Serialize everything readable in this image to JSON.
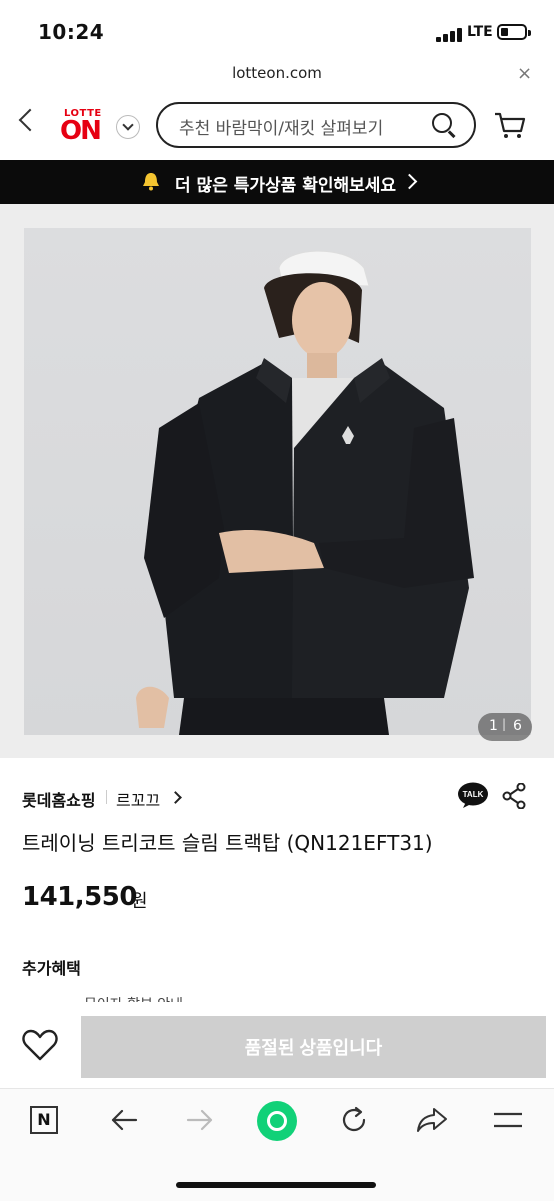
{
  "status_bar": {
    "time": "10:24",
    "network": "LTE",
    "battery_level": 0.25
  },
  "browser": {
    "url": "lotteon.com",
    "close_label": "×"
  },
  "header": {
    "logo_top": "LOTTE",
    "logo_main": "ON",
    "search_placeholder": "추천 바람막이/재킷 살펴보기"
  },
  "promo": {
    "text": "더 많은 특가상품 확인해보세요"
  },
  "gallery": {
    "current": "1",
    "separator": "|",
    "total": "6"
  },
  "product": {
    "seller": "롯데홈쇼핑",
    "brand": "르꼬끄",
    "talk_label": "TALK",
    "title": "트레이닝 트리코트 슬림 트랙탑 (QN121EFT31)",
    "price": "141,550",
    "currency": "원",
    "benefit_title": "추가혜택",
    "benefit_item": "무이자 할부 안내"
  },
  "purchase": {
    "soldout_label": "품절된 상품입니다"
  },
  "colors": {
    "brand_red": "#e60012",
    "promo_bg": "#0b0b0b",
    "soldout_bg": "#cfcfcf",
    "home_button": "#11d178"
  }
}
